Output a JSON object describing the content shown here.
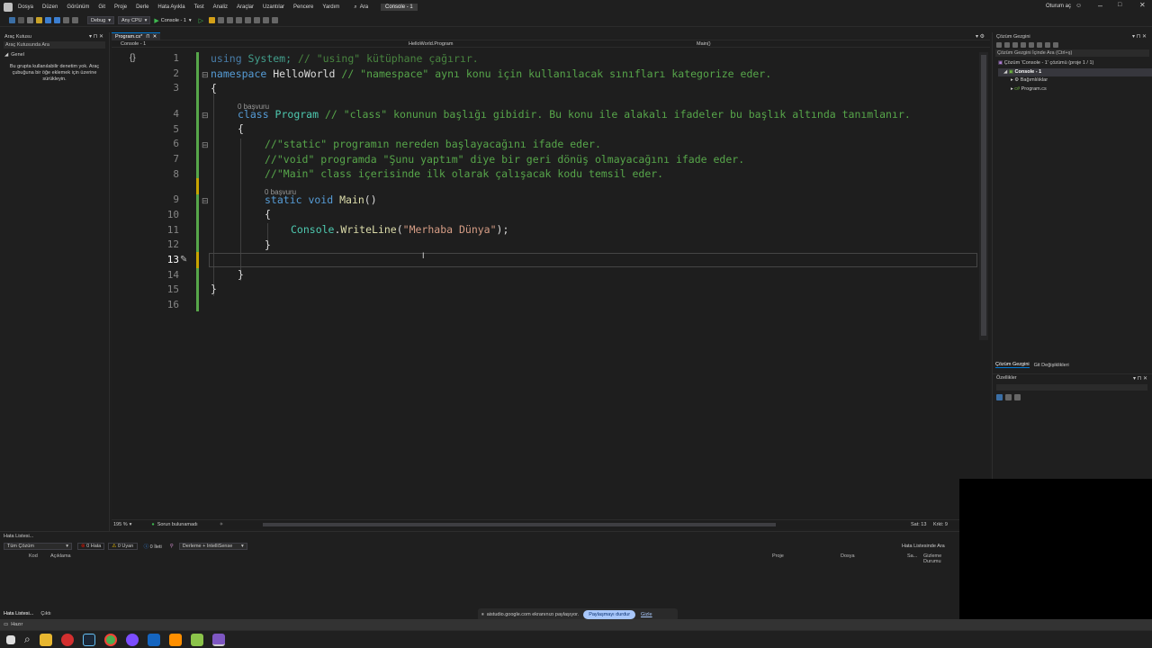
{
  "menu": {
    "items": [
      "Dosya",
      "Düzen",
      "Görünüm",
      "Git",
      "Proje",
      "Derle",
      "Hata Ayıkla",
      "Test",
      "Analiz",
      "Araçlar",
      "Uzantılar",
      "Pencere",
      "Yardım"
    ],
    "search_label": "Ara",
    "solution_badge": "Console - 1",
    "signin": "Oturum aç"
  },
  "toolbar": {
    "config": "Debug",
    "platform": "Any CPU",
    "run_label": "Console - 1"
  },
  "toolbox": {
    "title": "Araç Kutusu",
    "search_label": "Araç Kutusunda Ara",
    "group": "Genel",
    "empty_message": "Bu grupta kullanılabilir denetim yok. Araç çubuğuna bir öğe eklemek için üzerine sürükleyin."
  },
  "editor": {
    "tab_label": "Program.cs*",
    "project_dropdown": "Console - 1",
    "class_dropdown": "HelloWorld.Program",
    "member_dropdown": "Main()",
    "ref_class": "0 başvuru",
    "ref_main": "0 başvuru",
    "line_numbers": [
      "1",
      "2",
      "3",
      "4",
      "5",
      "6",
      "7",
      "8",
      "9",
      "10",
      "11",
      "12",
      "13",
      "14",
      "15",
      "16"
    ],
    "lines": {
      "l1": {
        "kw": "using",
        "ty": " System;",
        "cm": " // \"using\" kütüphane çağırır."
      },
      "l2": {
        "kw": "namespace",
        "pl": " HelloWorld",
        "cm": " // \"namespace\" aynı konu için kullanılacak sınıfları kategorize eder."
      },
      "l3": {
        "pl": "{"
      },
      "l4": {
        "kw": "class",
        "ty": " Program",
        "cm": " // \"class\" konunun başlığı gibidir. Bu konu ile alakalı ifadeler bu başlık altında tanımlanır."
      },
      "l5": {
        "pl": "{"
      },
      "l6": {
        "cm": "//\"static\" programın nereden başlayacağını ifade eder."
      },
      "l7": {
        "cm": "//\"void\" programda \"Şunu yaptım\" diye bir geri dönüş olmayacağını ifade eder."
      },
      "l8": {
        "cm": "//\"Main\" class içerisinde ilk olarak çalışacak kodu temsil eder."
      },
      "l9": {
        "kw": "static void",
        "fn": " Main",
        "pl": "()"
      },
      "l10": {
        "pl": "{"
      },
      "l11": {
        "ty": "Console",
        "pl1": ".",
        "fn": "WriteLine",
        "pl2": "(",
        "st": "\"Merhaba Dünya\"",
        "pl3": ");"
      },
      "l12": {
        "pl": "}"
      },
      "l14": {
        "pl": "}"
      },
      "l15": {
        "pl": "}"
      }
    },
    "zoom": "195 %",
    "issues": "Sorun bulunamadı",
    "position": "Sat: 13",
    "column": "Krkt: 9"
  },
  "solution_explorer": {
    "title": "Çözüm Gezgini",
    "search_label": "Çözüm Gezgini İçinde Ara (Ctrl+ş)",
    "solution_node": "Çözüm 'Console - 1' çözümü (proje 1 / 1)",
    "project_node": "Console - 1",
    "deps_node": "Bağımlılıklar",
    "file_node": "Program.cs",
    "bottom_tab_1": "Çözüm Gezgini",
    "bottom_tab_2": "Git Değişiklikleri",
    "properties_title": "Özellikler"
  },
  "error_list": {
    "title": "Hata Listesi...",
    "scope": "Tüm Çözüm",
    "errors": "0 Hata",
    "warnings": "0 Uyarı",
    "messages": "0 İleti",
    "filter": "Derleme + IntelliSense",
    "search_label": "Hata Listesinde Ara",
    "columns": [
      "Kod",
      "Açıklama",
      "Proje",
      "Dosya",
      "Sa...",
      "Gizleme Durumu"
    ],
    "tab_1": "Hata Listesi...",
    "tab_2": "Çıktı"
  },
  "status": {
    "ready": "Hazır"
  },
  "share_bar": {
    "message": "aistudio.google.com ekranınızı paylaşıyor.",
    "stop_button": "Paylaşmayı durdur",
    "hide_button": "Gizle"
  },
  "colors": {
    "keyword": "#569cd6",
    "type": "#4ec9b0",
    "comment": "#57a64a",
    "string": "#d69d85",
    "method": "#dcdcaa",
    "accent": "#0078d4",
    "error_red": "#e51400",
    "warning_yellow": "#ffcc00"
  }
}
